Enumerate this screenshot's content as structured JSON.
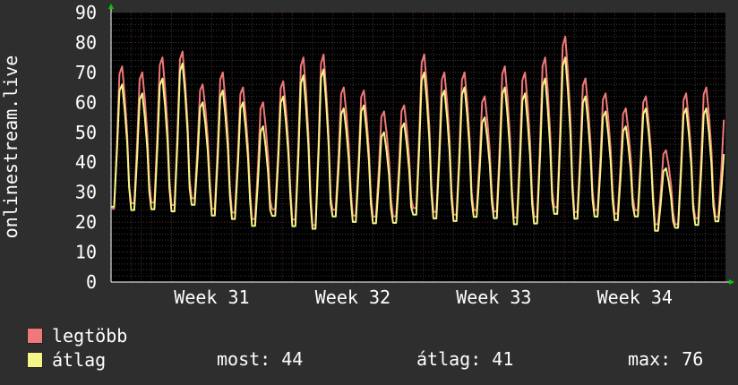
{
  "colors": {
    "background": "#2e2e2e",
    "plot_background": "#000000",
    "grid_minor": "#3a3a3a",
    "grid_major": "#5a2a2a",
    "text": "#ffffff",
    "max_series": "#f07878",
    "avg_series": "#f4f488",
    "arrow": "#00cc00"
  },
  "chart_data": {
    "type": "line",
    "ylabel": "onlinestream.live",
    "ylim": [
      0,
      90
    ],
    "yticks": [
      0,
      10,
      20,
      30,
      40,
      50,
      60,
      70,
      80,
      90
    ],
    "xlim": [
      0,
      30.5
    ],
    "week_ticks": [
      {
        "label": "Week 31",
        "x": 5.0
      },
      {
        "label": "Week 32",
        "x": 12.0
      },
      {
        "label": "Week 33",
        "x": 19.0
      },
      {
        "label": "Week 34",
        "x": 26.0
      }
    ],
    "week_boundaries": [
      1.5,
      8.5,
      15.5,
      22.5,
      29.5
    ],
    "daily_profile": {
      "day_offsets": [
        0.0,
        0.15,
        0.3,
        0.42,
        0.55,
        0.68,
        0.8,
        0.9
      ],
      "max_fraction": [
        0.05,
        0.05,
        0.5,
        0.95,
        1.0,
        0.85,
        0.55,
        0.2
      ]
    },
    "series": [
      {
        "name": "legtöbb",
        "daily_min": [
          22,
          24,
          24,
          23,
          26,
          22,
          21,
          19,
          22,
          18,
          16,
          22,
          20,
          20,
          20,
          22,
          21,
          20,
          22,
          21,
          19,
          19,
          22,
          21,
          22,
          21,
          22,
          18,
          17,
          19,
          20
        ],
        "daily_peak": [
          72,
          70,
          75,
          77,
          66,
          70,
          65,
          60,
          67,
          75,
          76,
          65,
          64,
          57,
          59,
          76,
          70,
          70,
          62,
          72,
          70,
          75,
          82,
          68,
          63,
          58,
          62,
          44,
          63,
          65,
          56
        ]
      },
      {
        "name": "átlag",
        "daily_min": [
          23,
          22,
          22,
          21,
          24,
          20,
          19,
          17,
          20,
          16,
          15,
          20,
          18,
          18,
          18,
          20,
          19,
          18,
          20,
          19,
          17,
          17,
          20,
          19,
          20,
          19,
          20,
          16,
          16,
          17,
          19
        ],
        "daily_peak": [
          66,
          63,
          68,
          73,
          60,
          64,
          60,
          52,
          62,
          69,
          71,
          58,
          59,
          50,
          53,
          70,
          64,
          65,
          55,
          65,
          63,
          68,
          75,
          62,
          57,
          52,
          58,
          38,
          58,
          58,
          44
        ]
      }
    ]
  },
  "legend": {
    "max_label": "legtöbb",
    "avg_label": "átlag"
  },
  "stats": {
    "now": "most: 44",
    "average": "átlag: 41",
    "max": "max: 76"
  }
}
